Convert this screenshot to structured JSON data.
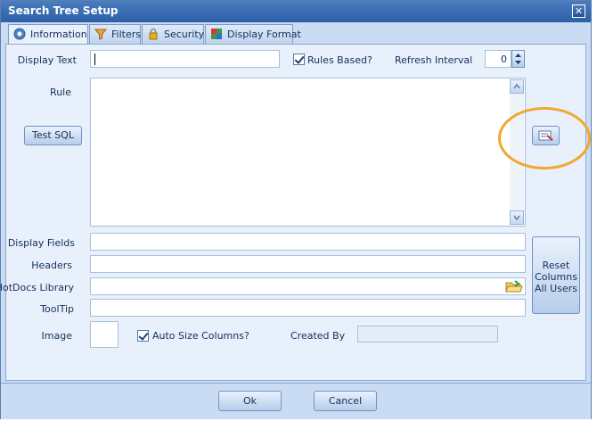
{
  "window": {
    "title": "Search Tree Setup",
    "close_glyph": "✕"
  },
  "tabs": [
    {
      "label": "Information",
      "icon": "gear-info-icon",
      "active": true
    },
    {
      "label": "Filters",
      "icon": "funnel-icon",
      "active": false
    },
    {
      "label": "Security",
      "icon": "lock-icon",
      "active": false
    },
    {
      "label": "Display Format",
      "icon": "palette-icon",
      "active": false
    }
  ],
  "form": {
    "display_text_label": "Display Text",
    "display_text_value": "",
    "rules_based_label": "Rules Based?",
    "rules_based_checked": true,
    "refresh_interval_label": "Refresh Interval",
    "refresh_interval_value": "0",
    "rule_label": "Rule",
    "rule_value": "",
    "test_sql_label": "Test SQL",
    "display_fields_label": "Display Fields",
    "headers_label": "Headers",
    "hotdocs_library_label": "HotDocs Library",
    "tooltip_label": "ToolTip",
    "image_label": "Image",
    "auto_size_label": "Auto Size Columns?",
    "auto_size_checked": true,
    "created_by_label": "Created By",
    "reset_columns_label_1": "Reset",
    "reset_columns_label_2": "Columns",
    "reset_columns_label_3": "All Users"
  },
  "footer": {
    "ok_label": "Ok",
    "cancel_label": "Cancel"
  },
  "colors": {
    "accent": "#2d5fa8",
    "highlight_ring": "#f0a830",
    "panel": "#e8f0fb"
  }
}
